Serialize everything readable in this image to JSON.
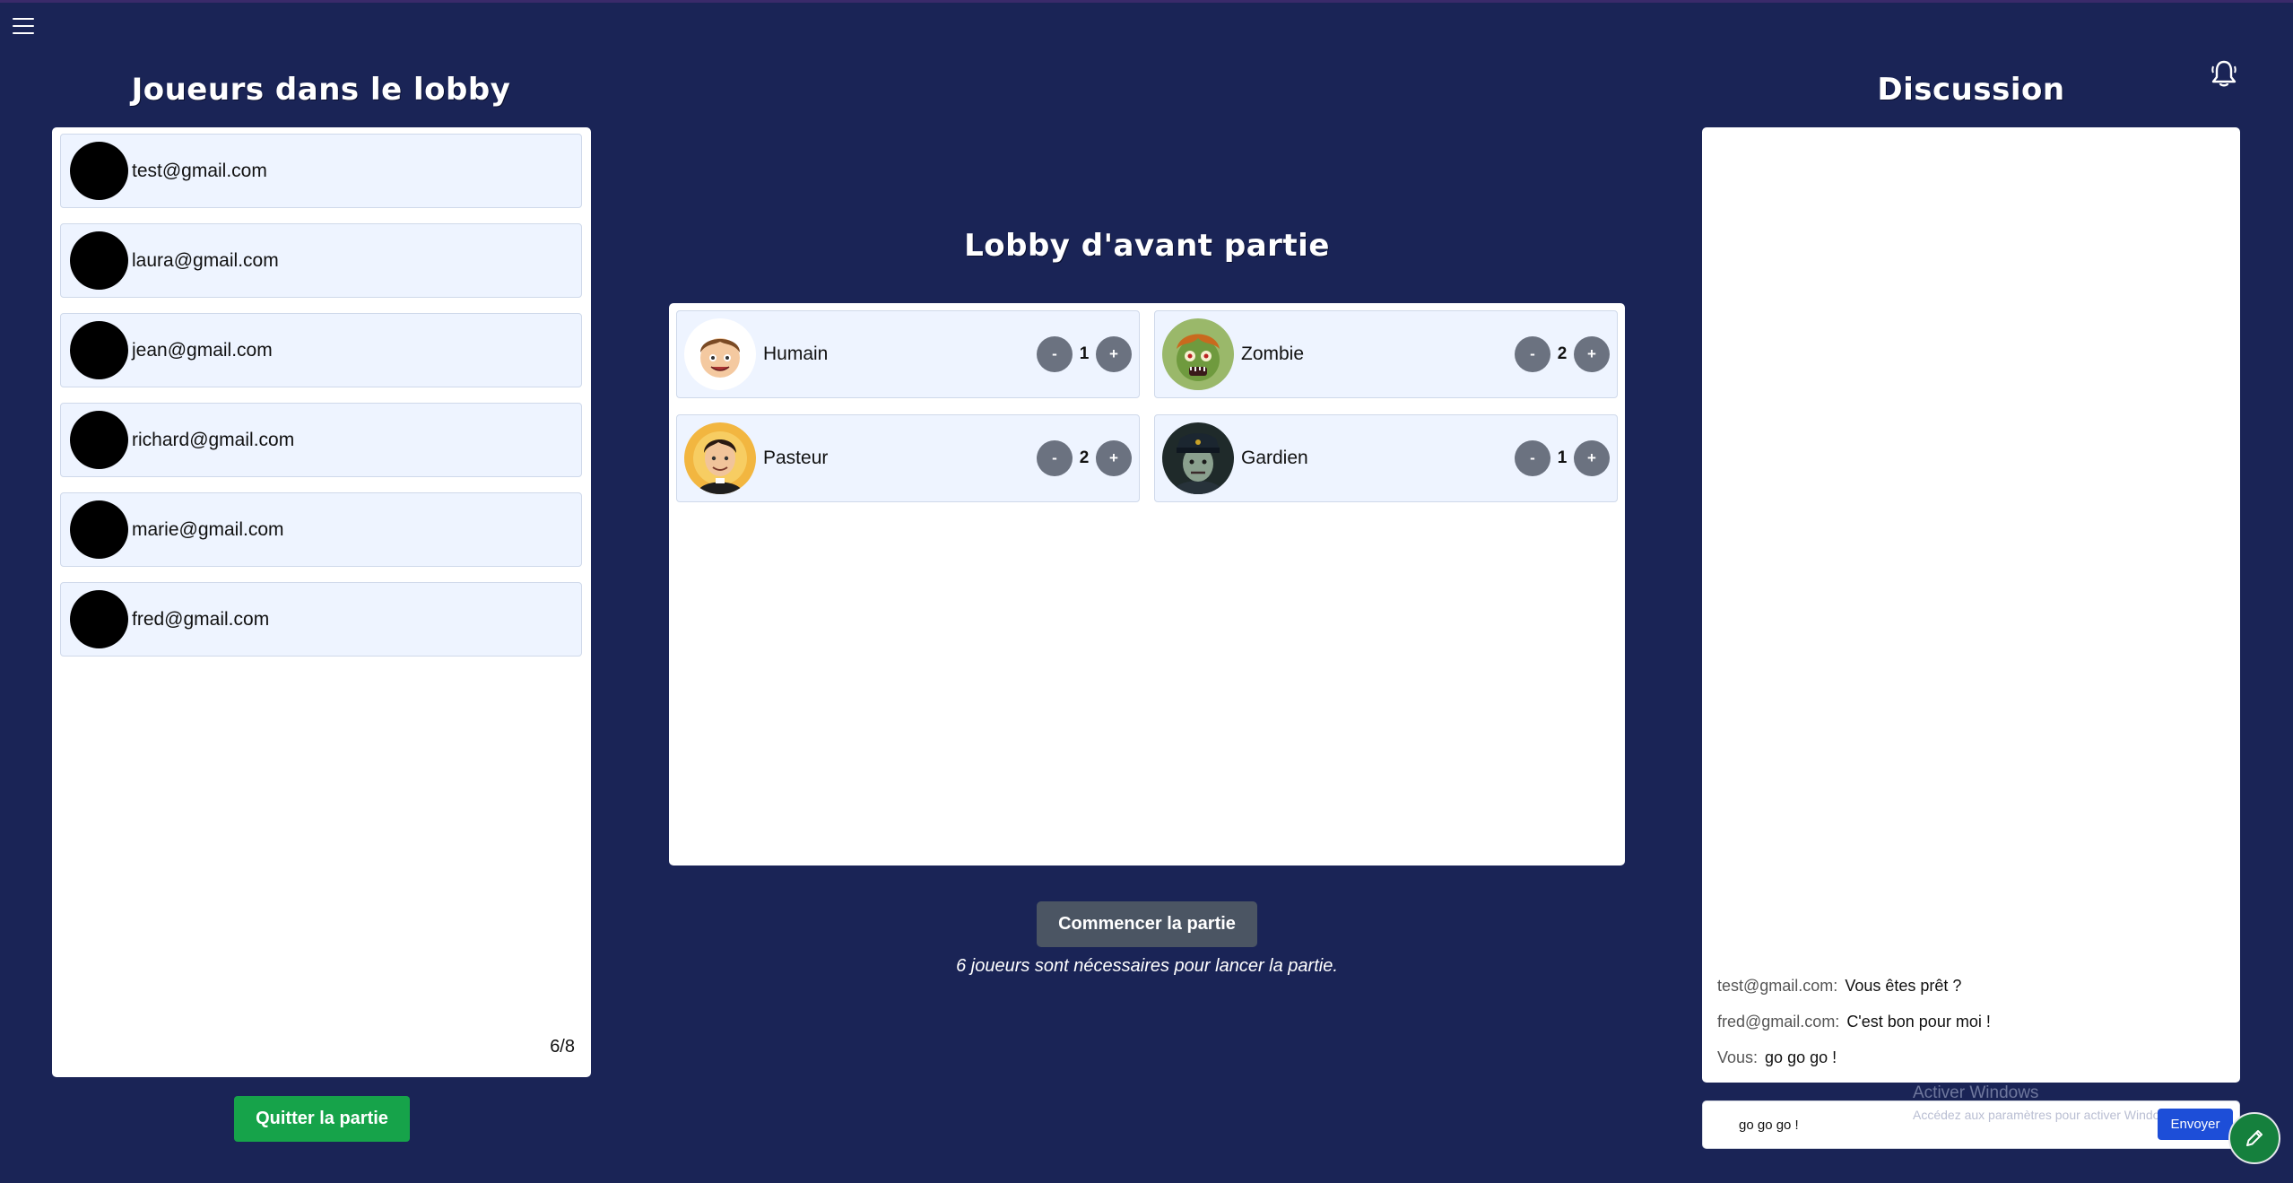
{
  "header": {
    "menu_icon": "hamburger-menu-icon",
    "notification_icon": "bell-icon"
  },
  "players": {
    "title": "Joueurs dans le lobby",
    "list": [
      "test@gmail.com",
      "laura@gmail.com",
      "jean@gmail.com",
      "richard@gmail.com",
      "marie@gmail.com",
      "fred@gmail.com"
    ],
    "count": "6/8",
    "quit_label": "Quitter la partie"
  },
  "lobby": {
    "title": "Lobby d'avant partie",
    "roles": [
      {
        "name": "Humain",
        "count": "1"
      },
      {
        "name": "Zombie",
        "count": "2"
      },
      {
        "name": "Pasteur",
        "count": "2"
      },
      {
        "name": "Gardien",
        "count": "1"
      }
    ],
    "minus_label": "-",
    "plus_label": "+",
    "start_label": "Commencer la partie",
    "hint": "6 joueurs sont nécessaires pour lancer la partie."
  },
  "chat": {
    "title": "Discussion",
    "messages": [
      {
        "author": "test@gmail.com:",
        "text": "Vous êtes prêt ?"
      },
      {
        "author": "fred@gmail.com:",
        "text": "C'est bon pour moi !"
      },
      {
        "author": "Vous:",
        "text": "go go go !"
      }
    ],
    "input_value": "go go go !",
    "send_label": "Envoyer"
  },
  "watermark": {
    "line1": "Activer Windows",
    "line2": "Accédez aux paramètres pour activer Windows."
  },
  "colors": {
    "background": "#1a2456",
    "quit_button": "#16a34a",
    "start_button": "#4b5563",
    "send_button": "#1d4ed8",
    "card": "#eef4ff"
  }
}
